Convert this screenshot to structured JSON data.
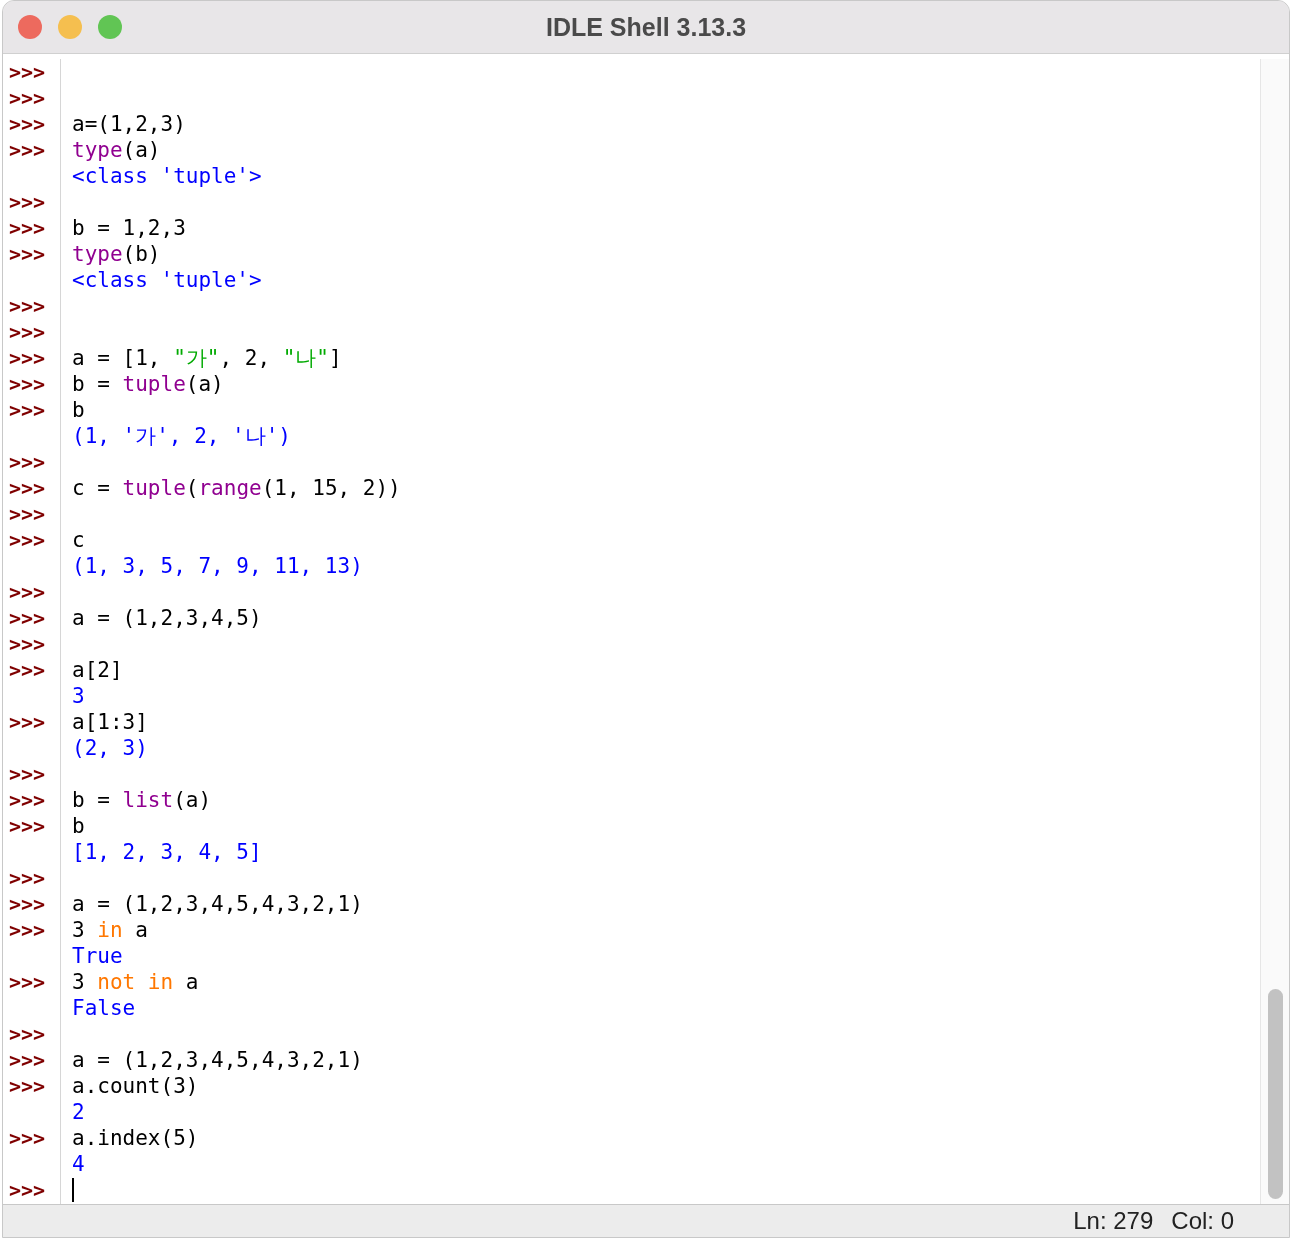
{
  "window": {
    "title": "IDLE Shell 3.13.3"
  },
  "lines": [
    {
      "prompt": ">>>"
    },
    {
      "prompt": ">>>"
    },
    {
      "prompt": ">>>",
      "spans": [
        {
          "kind": "plain",
          "text": "a=(1,2,3)"
        }
      ]
    },
    {
      "prompt": ">>>",
      "spans": [
        {
          "kind": "builtin",
          "text": "type"
        },
        {
          "kind": "plain",
          "text": "(a)"
        }
      ]
    },
    {
      "spans": [
        {
          "kind": "output",
          "text": "<class 'tuple'>"
        }
      ]
    },
    {
      "prompt": ">>>"
    },
    {
      "prompt": ">>>",
      "spans": [
        {
          "kind": "plain",
          "text": "b = 1,2,3"
        }
      ]
    },
    {
      "prompt": ">>>",
      "spans": [
        {
          "kind": "builtin",
          "text": "type"
        },
        {
          "kind": "plain",
          "text": "(b)"
        }
      ]
    },
    {
      "spans": [
        {
          "kind": "output",
          "text": "<class 'tuple'>"
        }
      ]
    },
    {
      "prompt": ">>>"
    },
    {
      "prompt": ">>>"
    },
    {
      "prompt": ">>>",
      "spans": [
        {
          "kind": "plain",
          "text": "a = [1, "
        },
        {
          "kind": "string",
          "text": "\"가\""
        },
        {
          "kind": "plain",
          "text": ", 2, "
        },
        {
          "kind": "string",
          "text": "\"나\""
        },
        {
          "kind": "plain",
          "text": "]"
        }
      ]
    },
    {
      "prompt": ">>>",
      "spans": [
        {
          "kind": "plain",
          "text": "b = "
        },
        {
          "kind": "builtin",
          "text": "tuple"
        },
        {
          "kind": "plain",
          "text": "(a)"
        }
      ]
    },
    {
      "prompt": ">>>",
      "spans": [
        {
          "kind": "plain",
          "text": "b"
        }
      ]
    },
    {
      "spans": [
        {
          "kind": "output",
          "text": "(1, '가', 2, '나')"
        }
      ]
    },
    {
      "prompt": ">>>"
    },
    {
      "prompt": ">>>",
      "spans": [
        {
          "kind": "plain",
          "text": "c = "
        },
        {
          "kind": "builtin",
          "text": "tuple"
        },
        {
          "kind": "plain",
          "text": "("
        },
        {
          "kind": "builtin",
          "text": "range"
        },
        {
          "kind": "plain",
          "text": "(1, 15, 2))"
        }
      ]
    },
    {
      "prompt": ">>>"
    },
    {
      "prompt": ">>>",
      "spans": [
        {
          "kind": "plain",
          "text": "c"
        }
      ]
    },
    {
      "spans": [
        {
          "kind": "output",
          "text": "(1, 3, 5, 7, 9, 11, 13)"
        }
      ]
    },
    {
      "prompt": ">>>"
    },
    {
      "prompt": ">>>",
      "spans": [
        {
          "kind": "plain",
          "text": "a = (1,2,3,4,5)"
        }
      ]
    },
    {
      "prompt": ">>>"
    },
    {
      "prompt": ">>>",
      "spans": [
        {
          "kind": "plain",
          "text": "a[2]"
        }
      ]
    },
    {
      "spans": [
        {
          "kind": "output",
          "text": "3"
        }
      ]
    },
    {
      "prompt": ">>>",
      "spans": [
        {
          "kind": "plain",
          "text": "a[1:3]"
        }
      ]
    },
    {
      "spans": [
        {
          "kind": "output",
          "text": "(2, 3)"
        }
      ]
    },
    {
      "prompt": ">>>"
    },
    {
      "prompt": ">>>",
      "spans": [
        {
          "kind": "plain",
          "text": "b = "
        },
        {
          "kind": "builtin",
          "text": "list"
        },
        {
          "kind": "plain",
          "text": "(a)"
        }
      ]
    },
    {
      "prompt": ">>>",
      "spans": [
        {
          "kind": "plain",
          "text": "b"
        }
      ]
    },
    {
      "spans": [
        {
          "kind": "output",
          "text": "[1, 2, 3, 4, 5]"
        }
      ]
    },
    {
      "prompt": ">>>"
    },
    {
      "prompt": ">>>",
      "spans": [
        {
          "kind": "plain",
          "text": "a = (1,2,3,4,5,4,3,2,1)"
        }
      ]
    },
    {
      "prompt": ">>>",
      "spans": [
        {
          "kind": "plain",
          "text": "3 "
        },
        {
          "kind": "keyword",
          "text": "in"
        },
        {
          "kind": "plain",
          "text": " a"
        }
      ]
    },
    {
      "spans": [
        {
          "kind": "output",
          "text": "True"
        }
      ]
    },
    {
      "prompt": ">>>",
      "spans": [
        {
          "kind": "plain",
          "text": "3 "
        },
        {
          "kind": "keyword",
          "text": "not in"
        },
        {
          "kind": "plain",
          "text": " a"
        }
      ]
    },
    {
      "spans": [
        {
          "kind": "output",
          "text": "False"
        }
      ]
    },
    {
      "prompt": ">>>"
    },
    {
      "prompt": ">>>",
      "spans": [
        {
          "kind": "plain",
          "text": "a = (1,2,3,4,5,4,3,2,1)"
        }
      ]
    },
    {
      "prompt": ">>>",
      "spans": [
        {
          "kind": "plain",
          "text": "a.count(3)"
        }
      ]
    },
    {
      "spans": [
        {
          "kind": "output",
          "text": "2"
        }
      ]
    },
    {
      "prompt": ">>>",
      "spans": [
        {
          "kind": "plain",
          "text": "a.index(5)"
        }
      ]
    },
    {
      "spans": [
        {
          "kind": "output",
          "text": "4"
        }
      ]
    },
    {
      "prompt": ">>>"
    }
  ],
  "cursor": true,
  "status_bar": {
    "line": "Ln: 279",
    "column": "Col: 0"
  }
}
